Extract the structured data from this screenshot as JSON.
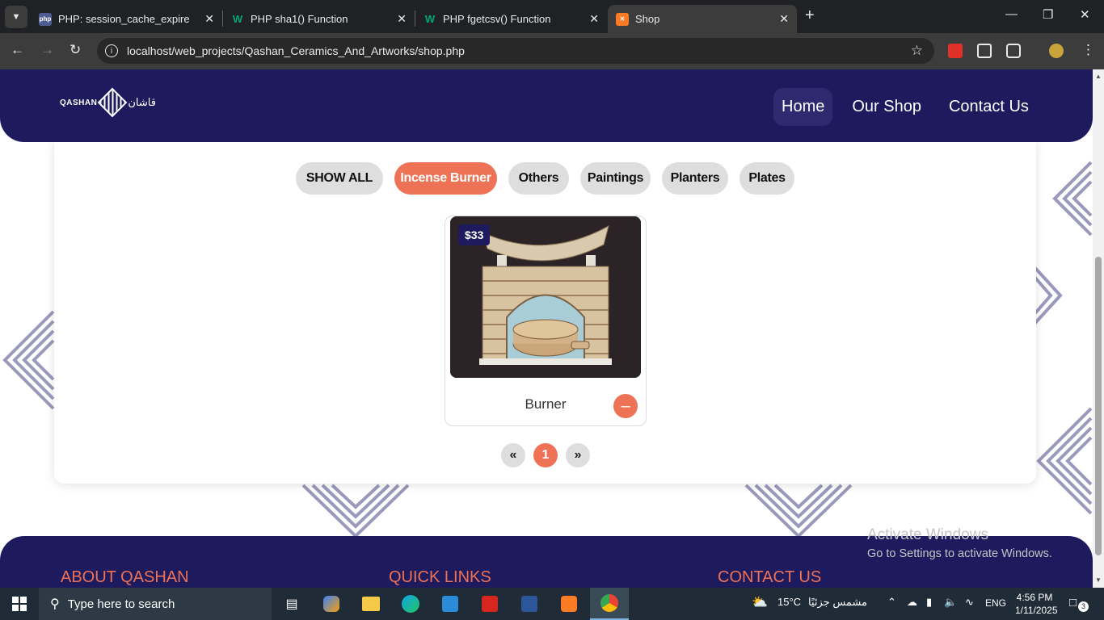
{
  "browser": {
    "tabs": [
      {
        "title": "PHP: session_cache_expire - Ma",
        "icon": "php-favicon",
        "active": false
      },
      {
        "title": "PHP sha1() Function",
        "icon": "w3schools-favicon",
        "active": false
      },
      {
        "title": "PHP fgetcsv() Function",
        "icon": "w3schools-favicon",
        "active": false
      },
      {
        "title": "Shop",
        "icon": "xampp-favicon",
        "active": true
      }
    ],
    "url": "localhost/web_projects/Qashan_Ceramics_And_Artworks/shop.php"
  },
  "site": {
    "logo_en": "QASHAN",
    "logo_ar": "قاشان",
    "nav": [
      {
        "label": "Home",
        "current": true
      },
      {
        "label": "Our Shop",
        "current": false
      },
      {
        "label": "Contact Us",
        "current": false
      }
    ],
    "filters": [
      {
        "label": "SHOW ALL",
        "active": false
      },
      {
        "label": "Incense Burner",
        "active": true
      },
      {
        "label": "Others",
        "active": false
      },
      {
        "label": "Paintings",
        "active": false
      },
      {
        "label": "Planters",
        "active": false
      },
      {
        "label": "Plates",
        "active": false
      }
    ],
    "products": [
      {
        "name": "Burner",
        "price": "$33"
      }
    ],
    "pagination": {
      "prev": "«",
      "current": "1",
      "next": "»"
    },
    "footer": {
      "about": "ABOUT QASHAN",
      "links": "QUICK LINKS",
      "contact": "CONTACT US"
    }
  },
  "watermark": {
    "line1": "Activate Windows",
    "line2": "Go to Settings to activate Windows."
  },
  "taskbar": {
    "search_placeholder": "Type here to search",
    "weather": "15°C",
    "weather_text": "مشمس جزئيًا",
    "language": "ENG",
    "time": "4:56 PM",
    "date": "1/11/2025",
    "notifications": "3"
  },
  "colors": {
    "brand_navy": "#1e1a5e",
    "accent_coral": "#ee7256"
  }
}
